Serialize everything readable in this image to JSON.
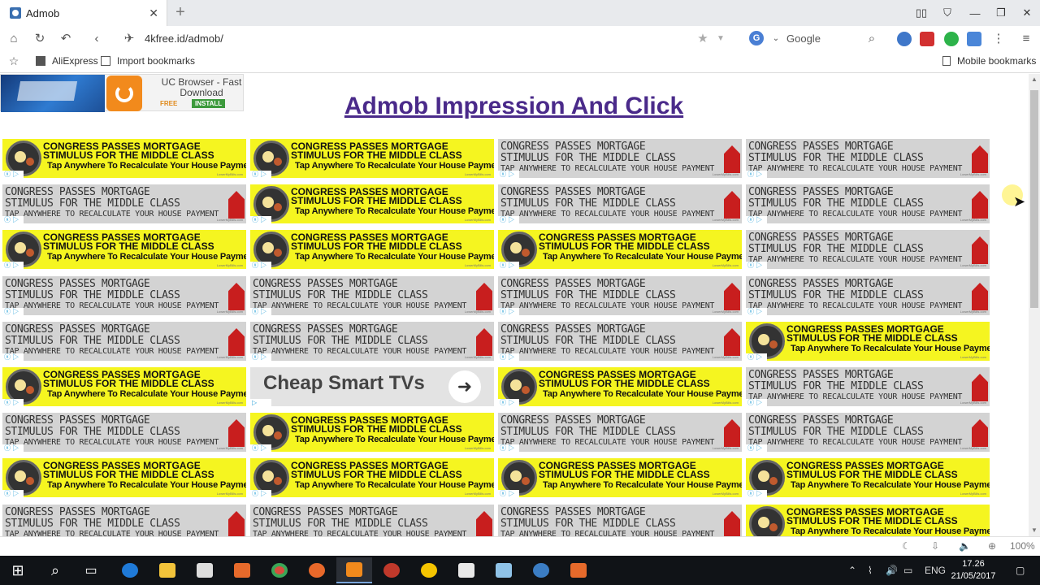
{
  "tab": {
    "title": "Admob",
    "close": "✕",
    "new": "+"
  },
  "window": {
    "min": "—",
    "max": "❐",
    "close": "✕"
  },
  "nav": {
    "url": "4kfree.id/admob/",
    "search_engine_letter": "G",
    "search_engine": "Google"
  },
  "bookmarks": [
    {
      "label": "AliExpress"
    },
    {
      "label": "Import bookmarks"
    }
  ],
  "mobile_bookmarks": "Mobile bookmarks",
  "uc_ad": {
    "title": "UC Browser - Fast Download",
    "free": "FREE",
    "install": "INSTALL"
  },
  "page": {
    "heading": "Admob Impression And Click"
  },
  "ad_text": {
    "line1": "CONGRESS PASSES MORTGAGE",
    "line2": "STIMULUS FOR THE MIDDLE CLASS",
    "cta_yellow": "Tap Anywhere To Recalculate Your House Payment",
    "cta_gray": "TAP ANYWHERE TO RECALCULATE YOUR HOUSE PAYMENT",
    "fine": "LowerMyBills.com",
    "tv": "Cheap Smart TVs",
    "tv_arrow": "➜"
  },
  "ad_grid": [
    [
      "yellow",
      "yellow",
      "gray",
      "gray"
    ],
    [
      "gray",
      "yellow",
      "gray",
      "gray"
    ],
    [
      "yellow",
      "yellow",
      "yellow",
      "gray"
    ],
    [
      "gray",
      "gray",
      "gray",
      "gray"
    ],
    [
      "gray",
      "gray",
      "gray",
      "yellow"
    ],
    [
      "yellow",
      "tv",
      "yellow",
      "gray"
    ],
    [
      "gray",
      "yellow",
      "gray",
      "gray"
    ],
    [
      "yellow",
      "yellow",
      "yellow",
      "yellow"
    ],
    [
      "gray",
      "gray",
      "gray",
      "yellow"
    ]
  ],
  "status": {
    "zoom": "100%"
  },
  "taskbar": {
    "lang": "ENG",
    "time": "17.26",
    "date": "21/05/2017"
  },
  "colors": {
    "heading": "#4a2a8a",
    "ad_yellow": "#f5f520",
    "ad_gray": "#d3d3d3",
    "taskbar": "#101317"
  }
}
